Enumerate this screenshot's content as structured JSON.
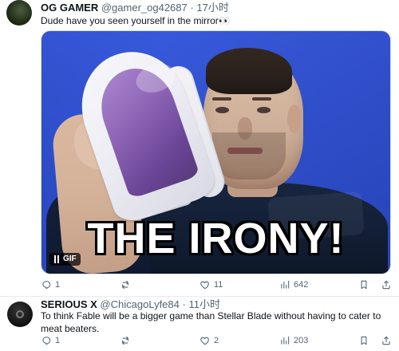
{
  "tweets": [
    {
      "display_name": "OG GAMER",
      "handle": "@gamer_og42687",
      "separator": "·",
      "timestamp": "17小时",
      "text": "Dude have you seen yourself in the mirror👀",
      "media": {
        "caption": "THE IRONY!",
        "gif_label": "GIF"
      },
      "actions": {
        "reply_count": "1",
        "retweet_count": "",
        "like_count": "11",
        "view_count": "642"
      }
    },
    {
      "display_name": "SERIOUS X",
      "handle": "@ChicagoLyfe84",
      "separator": "·",
      "timestamp": "11小时",
      "text": "To think Fable will be a bigger game than Stellar Blade without having to cater to meat beaters.",
      "actions": {
        "reply_count": "1",
        "retweet_count": "",
        "like_count": "2",
        "view_count": "203"
      }
    }
  ],
  "icons": {
    "reply": "reply-icon",
    "retweet": "retweet-icon",
    "like": "heart-icon",
    "views": "views-icon",
    "bookmark": "bookmark-icon",
    "share": "share-icon",
    "pause": "pause-icon"
  },
  "colors": {
    "text_primary": "#0f1419",
    "text_secondary": "#536471",
    "divider": "#e6ecf0",
    "gif_background": "#2f52d9"
  }
}
